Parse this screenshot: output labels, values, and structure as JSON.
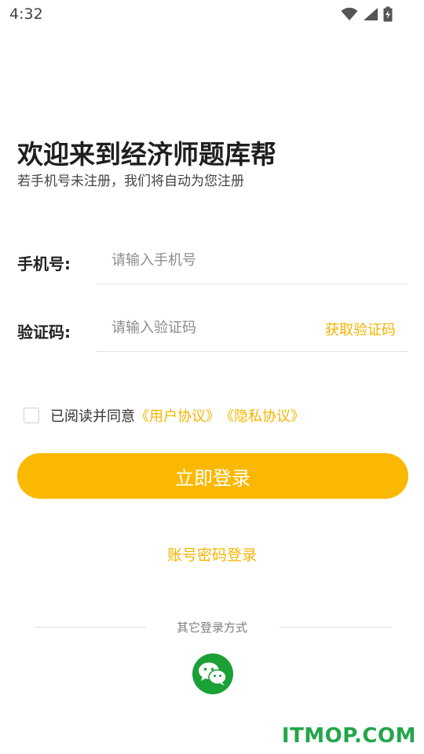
{
  "status_bar": {
    "time": "4:32"
  },
  "header": {
    "title": "欢迎来到经济师题库帮",
    "subtitle": "若手机号未注册，我们将自动为您注册"
  },
  "form": {
    "phone": {
      "label": "手机号:",
      "placeholder": "请输入手机号",
      "value": ""
    },
    "code": {
      "label": "验证码:",
      "placeholder": "请输入验证码",
      "value": "",
      "get_code_label": "获取验证码"
    }
  },
  "agreement": {
    "checked": false,
    "text": "已阅读并同意",
    "user_agreement": "《用户协议》",
    "privacy_agreement": "《隐私协议》"
  },
  "actions": {
    "login_label": "立即登录",
    "password_login_label": "账号密码登录"
  },
  "other_login": {
    "title": "其它登录方式",
    "icons": [
      "wechat-icon"
    ]
  },
  "watermark": "ITMOP.COM",
  "colors": {
    "accent": "#fbb800",
    "link": "#f4b400",
    "wechat": "#1aa035",
    "watermark": "#22a64a"
  }
}
